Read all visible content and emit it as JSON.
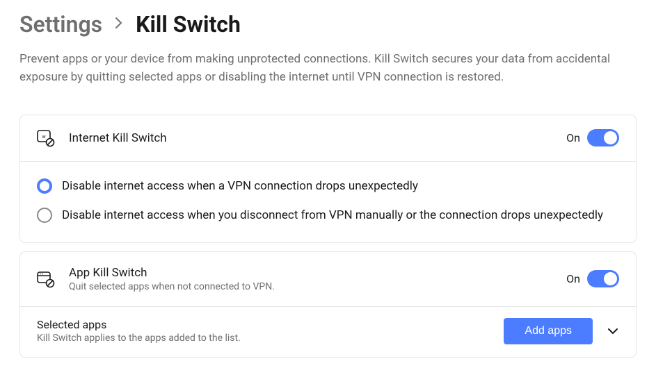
{
  "breadcrumb": {
    "parent": "Settings",
    "current": "Kill Switch"
  },
  "description": "Prevent apps or your device from making unprotected connections. Kill Switch secures your data from accidental exposure by quitting selected apps or disabling the internet until VPN connection is restored.",
  "internetKillSwitch": {
    "title": "Internet Kill Switch",
    "toggleLabel": "On",
    "toggleState": true,
    "options": [
      {
        "label": "Disable internet access when a VPN connection drops unexpectedly",
        "selected": true
      },
      {
        "label": "Disable internet access when you disconnect from VPN manually or the connection drops unexpectedly",
        "selected": false
      }
    ]
  },
  "appKillSwitch": {
    "title": "App Kill Switch",
    "subtitle": "Quit selected apps when not connected to VPN.",
    "toggleLabel": "On",
    "toggleState": true,
    "selectedApps": {
      "title": "Selected apps",
      "subtitle": "Kill Switch applies to the apps added to the list.",
      "buttonLabel": "Add apps"
    }
  }
}
